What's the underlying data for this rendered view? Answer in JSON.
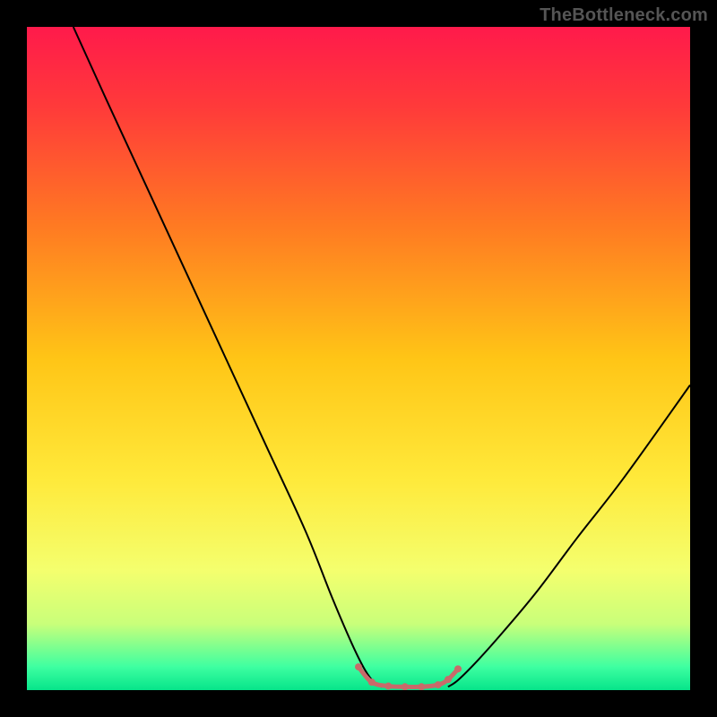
{
  "watermark": "TheBottleneck.com",
  "chart_data": {
    "type": "line",
    "title": "",
    "xlabel": "",
    "ylabel": "",
    "xlim": [
      0,
      100
    ],
    "ylim": [
      0,
      100
    ],
    "legend": false,
    "grid": false,
    "background_gradient_stops": [
      {
        "pos": 0.0,
        "color": "#ff1a4b"
      },
      {
        "pos": 0.12,
        "color": "#ff3a3a"
      },
      {
        "pos": 0.3,
        "color": "#ff7a22"
      },
      {
        "pos": 0.5,
        "color": "#ffc516"
      },
      {
        "pos": 0.68,
        "color": "#ffe93a"
      },
      {
        "pos": 0.82,
        "color": "#f4ff6e"
      },
      {
        "pos": 0.9,
        "color": "#c9ff7a"
      },
      {
        "pos": 0.965,
        "color": "#3effa1"
      },
      {
        "pos": 1.0,
        "color": "#06e48a"
      }
    ],
    "series": [
      {
        "name": "curve-left",
        "stroke": "#000000",
        "stroke_width": 2,
        "x": [
          7,
          12,
          18,
          24,
          30,
          36,
          42,
          46,
          49,
          51,
          52.5,
          53.5
        ],
        "y": [
          100,
          89,
          76,
          63,
          50,
          37,
          24,
          14,
          7,
          3,
          1,
          0.5
        ]
      },
      {
        "name": "curve-right",
        "stroke": "#000000",
        "stroke_width": 2,
        "x": [
          63.5,
          65,
          68,
          72,
          77,
          83,
          90,
          100
        ],
        "y": [
          0.5,
          1.5,
          4.5,
          9,
          15,
          23,
          32,
          46
        ]
      },
      {
        "name": "flat-dots",
        "stroke": "#c86a6a",
        "stroke_width": 5,
        "linecap": "round",
        "marker_radius": 4,
        "x": [
          50,
          52,
          54.5,
          57,
          59.5,
          62,
          63.5,
          65
        ],
        "y": [
          3.5,
          1.2,
          0.6,
          0.5,
          0.5,
          0.8,
          1.6,
          3.2
        ]
      }
    ]
  }
}
